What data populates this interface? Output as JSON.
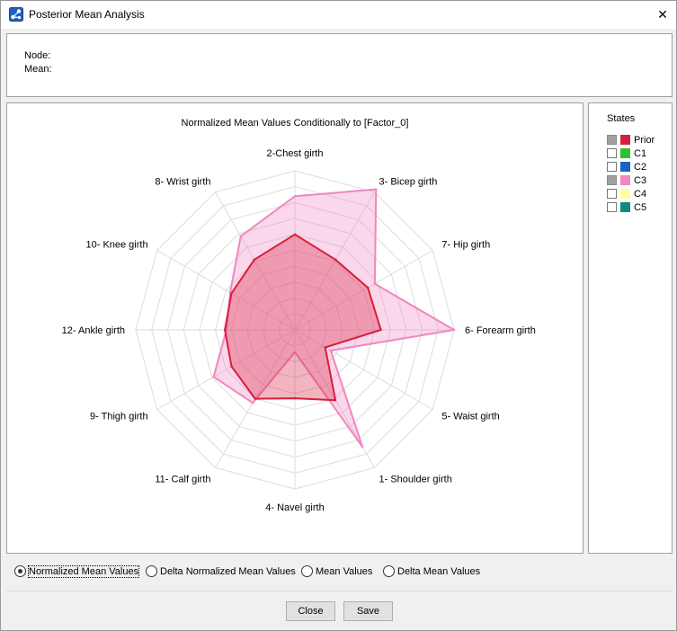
{
  "window": {
    "title": "Posterior Mean Analysis",
    "close_glyph": "✕",
    "icon": "network-icon"
  },
  "info": {
    "node_label": "Node:",
    "mean_label": "Mean:"
  },
  "legend": {
    "title": "States",
    "items": [
      {
        "label": "Prior",
        "color": "#d81e3c",
        "checked": true
      },
      {
        "label": "C1",
        "color": "#2ec02e",
        "checked": false
      },
      {
        "label": "C2",
        "color": "#1565c0",
        "checked": false
      },
      {
        "label": "C3",
        "color": "#ef87c0",
        "checked": true
      },
      {
        "label": "C4",
        "color": "#ffff99",
        "checked": false
      },
      {
        "label": "C5",
        "color": "#0e8a7e",
        "checked": false
      }
    ]
  },
  "chart_data": {
    "type": "radar",
    "title": "Normalized Mean Values Conditionally to [Factor_0]",
    "axes": [
      "2-Chest girth",
      "3- Bicep girth",
      "7- Hip girth",
      "6- Forearm girth",
      "5- Waist girth",
      "1- Shoulder girth",
      "4- Navel girth",
      "11- Calf girth",
      "9- Thigh girth",
      "12- Ankle girth",
      "10- Knee girth",
      "8- Wrist girth"
    ],
    "range": [
      0,
      10
    ],
    "rings": 10,
    "grid": true,
    "series": [
      {
        "name": "C3",
        "color": "#ef87c0",
        "values": [
          8.4,
          10.2,
          5.8,
          10.0,
          2.6,
          8.5,
          1.4,
          5.3,
          5.9,
          4.3,
          4.7,
          6.8
        ]
      },
      {
        "name": "Prior",
        "color": "#d81e3c",
        "values": [
          6.0,
          5.1,
          5.3,
          5.4,
          2.2,
          5.1,
          4.3,
          5.0,
          4.6,
          4.4,
          4.6,
          5.1
        ]
      }
    ]
  },
  "radio_options": {
    "items": [
      {
        "label": "Normalized Mean Values",
        "selected": true
      },
      {
        "label": "Delta Normalized Mean Values",
        "selected": false
      },
      {
        "label": "Mean Values",
        "selected": false
      },
      {
        "label": "Delta Mean Values",
        "selected": false
      }
    ]
  },
  "buttons": {
    "close_label": "Close",
    "save_label": "Save"
  }
}
